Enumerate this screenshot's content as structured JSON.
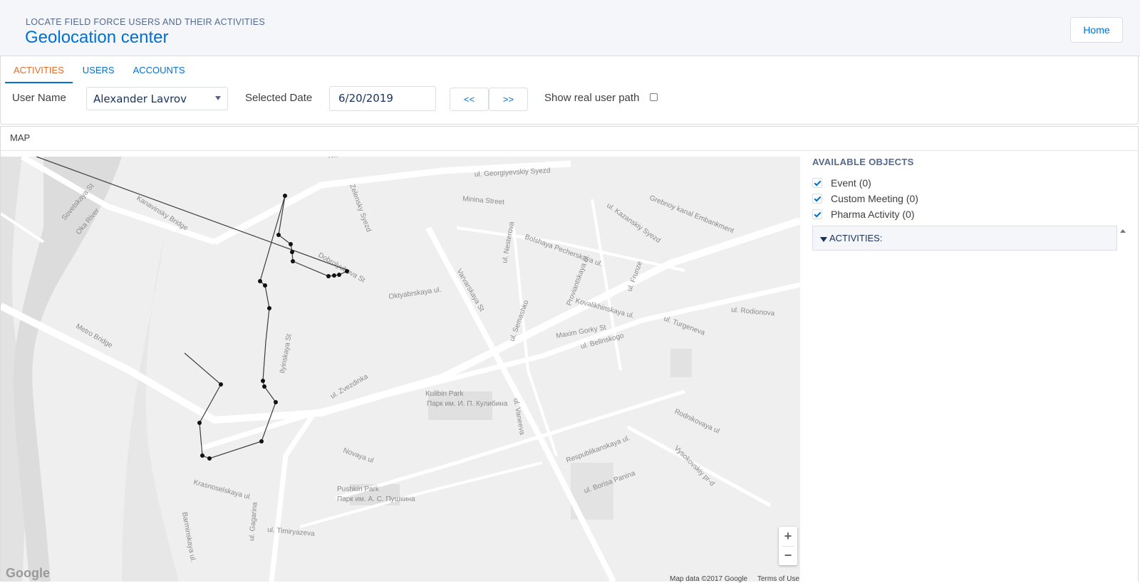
{
  "header": {
    "subtitle": "LOCATE FIELD FORCE USERS AND THEIR ACTIVITIES",
    "title": "Geolocation center",
    "home_label": "Home"
  },
  "tabs": [
    {
      "label": "ACTIVITIES",
      "active": true
    },
    {
      "label": "USERS",
      "active": false
    },
    {
      "label": "ACCOUNTS",
      "active": false
    }
  ],
  "filters": {
    "user_name_label": "User Name",
    "user_name_value": "Alexander Lavrov",
    "selected_date_label": "Selected Date",
    "selected_date_value": "6/20/2019",
    "prev_label": "<<",
    "next_label": ">>",
    "show_path_label": "Show real user path",
    "show_path_checked": false
  },
  "map_section": {
    "title": "MAP",
    "attribution": "Map data ©2017 Google",
    "terms": "Terms of Use",
    "zoom_in": "+",
    "zoom_out": "−",
    "logo": "Google",
    "street_labels": [
      "Nizhnevolzhskaya embankment",
      "ul. Georgiyevskiy Syezd",
      "Minina Street",
      "Grebnoy kanal Embankment",
      "ul. Kazanskiy Syezd",
      "Kanavinsky Bridge",
      "Sovetskaya St",
      "Oka River",
      "Dobrolyubova St",
      "Oktyabrskaya ul.",
      "Varvarskaya St",
      "Bolshaya Pecherskaya ul.",
      "ul. Rodionova",
      "Maxim Gorky St",
      "ul. Belinskogo",
      "Metro Bridge",
      "Ilyinskaya St",
      "Kulibin Park",
      "Парк им. И. П. Кулибина",
      "Pushkin Park",
      "Парк им. А. С. Пушкина",
      "ul. Vaneeva",
      "Respublikanskaya ul.",
      "Vysokovskiy pr-d",
      "ul. Zvezdinka",
      "Novaya ul",
      "ul. Timiryazeva",
      "ul. Gagarina",
      "Barminskaya ul.",
      "Krasnoselskaya ul.",
      "ul. Semashko",
      "ul. Turgeneva",
      "Rodnikovaya ul",
      "ul. Borisa Panina",
      "Kovalikhinskaya ul.",
      "Zelensky Syezd",
      "ul. Nesterova",
      "ul. Frunze",
      "Proviantskaya ul."
    ]
  },
  "available_objects": {
    "title": "AVAILABLE OBJECTS",
    "items": [
      {
        "label": "Event (0)",
        "checked": true
      },
      {
        "label": "Custom Meeting (0)",
        "checked": true
      },
      {
        "label": "Pharma Activity (0)",
        "checked": true
      }
    ],
    "accordion_label": "ACTIVITIES:"
  },
  "colors": {
    "brand": "#0070d2",
    "active_tab": "#e06c2e",
    "header_bg": "#f4f6f9"
  }
}
